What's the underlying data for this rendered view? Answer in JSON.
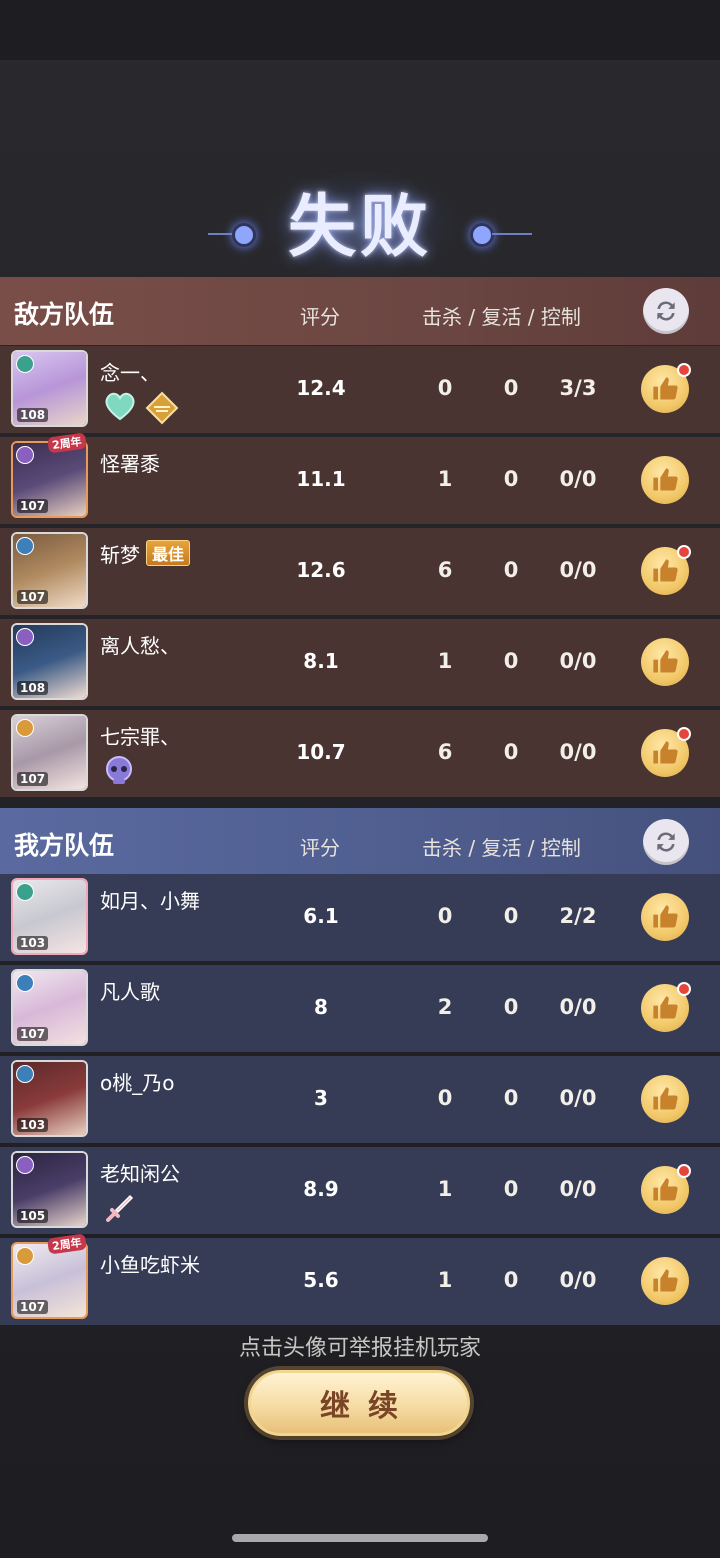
{
  "result_title": "失败",
  "enemy_team": {
    "label": "敌方队伍",
    "score_header": "评分",
    "stats_header": "击杀 / 复活 / 控制",
    "players": [
      {
        "name": "念一、",
        "level": "108",
        "score": "12.4",
        "kills": "0",
        "revives": "0",
        "controls": "3/3",
        "badge": "",
        "like_notify": true
      },
      {
        "name": "怪署黍",
        "level": "107",
        "score": "11.1",
        "kills": "1",
        "revives": "0",
        "controls": "0/0",
        "badge": "",
        "anniversary": "2周年",
        "like_notify": false
      },
      {
        "name": "斩梦",
        "level": "107",
        "score": "12.6",
        "kills": "6",
        "revives": "0",
        "controls": "0/0",
        "badge": "最佳",
        "like_notify": true
      },
      {
        "name": "离人愁、",
        "level": "108",
        "score": "8.1",
        "kills": "1",
        "revives": "0",
        "controls": "0/0",
        "badge": "",
        "like_notify": false
      },
      {
        "name": "七宗罪、",
        "level": "107",
        "score": "10.7",
        "kills": "6",
        "revives": "0",
        "controls": "0/0",
        "badge": "",
        "like_notify": true
      }
    ]
  },
  "ally_team": {
    "label": "我方队伍",
    "score_header": "评分",
    "stats_header": "击杀 / 复活 / 控制",
    "players": [
      {
        "name": "如月、小舞",
        "level": "103",
        "score": "6.1",
        "kills": "0",
        "revives": "0",
        "controls": "2/2",
        "like_notify": false
      },
      {
        "name": "凡人歌",
        "level": "107",
        "score": "8",
        "kills": "2",
        "revives": "0",
        "controls": "0/0",
        "like_notify": true
      },
      {
        "name": "o桃_乃o",
        "level": "103",
        "score": "3",
        "kills": "0",
        "revives": "0",
        "controls": "0/0",
        "like_notify": false
      },
      {
        "name": "老知闲公",
        "level": "105",
        "score": "8.9",
        "kills": "1",
        "revives": "0",
        "controls": "0/0",
        "like_notify": true
      },
      {
        "name": "小鱼吃虾米",
        "level": "107",
        "score": "5.6",
        "kills": "1",
        "revives": "0",
        "controls": "0/0",
        "anniversary": "2周年",
        "like_notify": false
      }
    ]
  },
  "hint": "点击头像可举报挂机玩家",
  "continue_label": "继续",
  "colors": {
    "enemy_header": "#7a4e48",
    "enemy_row": "#4a3431",
    "ally_header": "#5a6aa0",
    "ally_row": "#363c55",
    "like_button": "#f2c96a",
    "notify_dot": "#e5453b"
  }
}
